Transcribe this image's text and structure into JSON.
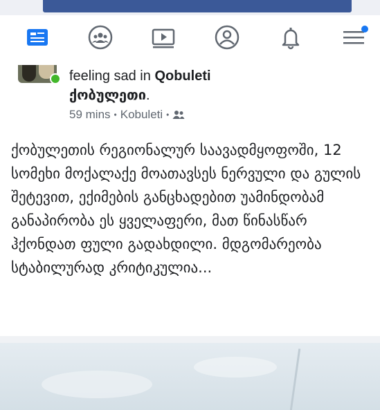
{
  "nav": {
    "items": [
      {
        "icon": "news-feed-icon",
        "active": true
      },
      {
        "icon": "groups-icon"
      },
      {
        "icon": "watch-icon"
      },
      {
        "icon": "profile-icon"
      },
      {
        "icon": "notifications-icon"
      },
      {
        "icon": "menu-icon",
        "badge": true
      }
    ],
    "active_color": "#1877f2",
    "inactive_color": "#606770"
  },
  "post": {
    "feeling": "feeling sad in",
    "place": "Qobuleti",
    "place_local": "ქობულეთი",
    "time": "59 mins",
    "location": "Kobuleti",
    "audience_icon": "friends-icon",
    "body": "ქობულეთის რეგიონალურ საავადმყოფოში, 12 სომეხი მოქალაქე მოათავსეს ნერვული და გულის შეტევით, ექიმების განცხადებით უამინდობამ განაპირობა ეს ყველაფერი, მათ წინასწარ ჰქონდათ ფული გადახდილი. მდგომარეობა სტაბილურად კრიტიკულია..."
  }
}
